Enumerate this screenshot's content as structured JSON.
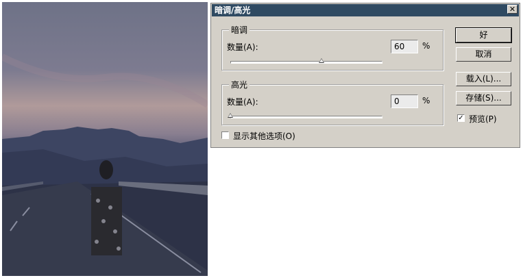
{
  "dialog": {
    "title": "暗调/高光",
    "close_glyph": "✕",
    "shadows": {
      "group_label": "暗调",
      "amount_label": "数量(A):",
      "amount_value": "60",
      "amount_unit": "%",
      "slider_fraction": 0.6
    },
    "highlights": {
      "group_label": "高光",
      "amount_label": "数量(A):",
      "amount_value": "0",
      "amount_unit": "%",
      "slider_fraction": 0.0
    },
    "more_options_label": "显示其他选项(O)",
    "more_options_checked": false,
    "buttons": {
      "ok": "好",
      "cancel": "取消",
      "load": "载入(L)...",
      "save": "存储(S)..."
    },
    "preview_label": "预览(P)",
    "preview_checked": true,
    "check_glyph": "✓"
  },
  "colors": {
    "titlebar": "#2f4a62",
    "dialog_bg": "#d4d0c8"
  }
}
